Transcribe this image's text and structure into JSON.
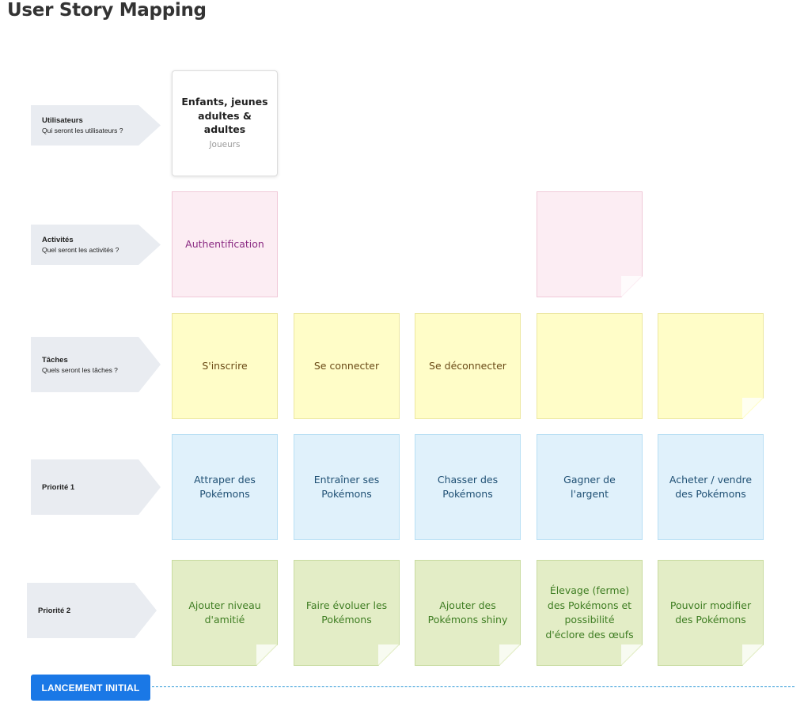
{
  "page_title": "User Story Mapping",
  "rows": {
    "users": {
      "title": "Utilisateurs",
      "subtitle": "Qui seront les utilisateurs ?"
    },
    "activities": {
      "title": "Activités",
      "subtitle": "Quel seront les activités ?"
    },
    "tasks": {
      "title": "Tâches",
      "subtitle": "Quels seront les tâches ?"
    },
    "priority1": {
      "title": "Priorité 1",
      "subtitle": ""
    },
    "priority2": {
      "title": "Priorité 2",
      "subtitle": ""
    }
  },
  "user_card": {
    "name": "Enfants, jeunes adultes & adultes",
    "role": "Joueurs"
  },
  "activities": [
    "Authentification",
    ""
  ],
  "tasks": [
    "S'inscrire",
    "Se connecter",
    "Se déconnecter",
    "",
    ""
  ],
  "priority1": [
    "Attraper des Pokémons",
    "Entraîner ses Pokémons",
    "Chasser des Pokémons",
    "Gagner de l'argent",
    "Acheter / vendre des Pokémons"
  ],
  "priority2": [
    "Ajouter niveau d'amitié",
    "Faire évoluer les Pokémons",
    "Ajouter des Pokémons shiny",
    "Élevage (ferme) des Pokémons et possibilité d'éclore des œufs",
    "Pouvoir modifier des Pokémons"
  ],
  "release": {
    "label": "LANCEMENT INITIAL"
  },
  "colors": {
    "activity_card": "#fcedf3",
    "task_card": "#fffdc8",
    "priority1_card": "#e0f1fb",
    "priority2_card": "#e3edc6",
    "release_button": "#1a78e6",
    "row_label_bg": "#e9ecf1"
  }
}
